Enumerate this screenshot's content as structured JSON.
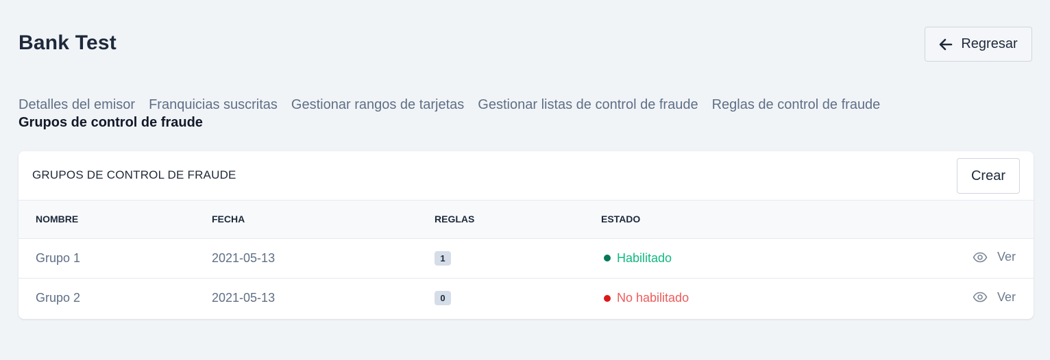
{
  "header": {
    "title": "Bank Test",
    "back_label": "Regresar"
  },
  "tabs": [
    {
      "label": "Detalles del emisor",
      "active": false
    },
    {
      "label": "Franquicias suscritas",
      "active": false
    },
    {
      "label": "Gestionar rangos de tarjetas",
      "active": false
    },
    {
      "label": "Gestionar listas de control de fraude",
      "active": false
    },
    {
      "label": "Reglas de control de fraude",
      "active": false
    },
    {
      "label": "Grupos de control de fraude",
      "active": true
    }
  ],
  "card": {
    "title": "GRUPOS DE CONTROL DE FRAUDE",
    "create_label": "Crear",
    "columns": [
      "NOMBRE",
      "FECHA",
      "REGLAS",
      "ESTADO"
    ],
    "rows": [
      {
        "name": "Grupo 1",
        "date": "2021-05-13",
        "rules": "1",
        "status": "Habilitado",
        "status_type": "enabled",
        "action": "Ver"
      },
      {
        "name": "Grupo 2",
        "date": "2021-05-13",
        "rules": "0",
        "status": "No habilitado",
        "status_type": "disabled",
        "action": "Ver"
      }
    ]
  },
  "colors": {
    "background": "#f1f4f7",
    "enabled_text": "#10b981",
    "enabled_dot": "#047857",
    "disabled_text": "#ef5a5a",
    "disabled_dot": "#dc1717"
  },
  "icons": {
    "back": "arrow-left-icon",
    "view": "eye-icon",
    "status": "status-dot-icon"
  }
}
